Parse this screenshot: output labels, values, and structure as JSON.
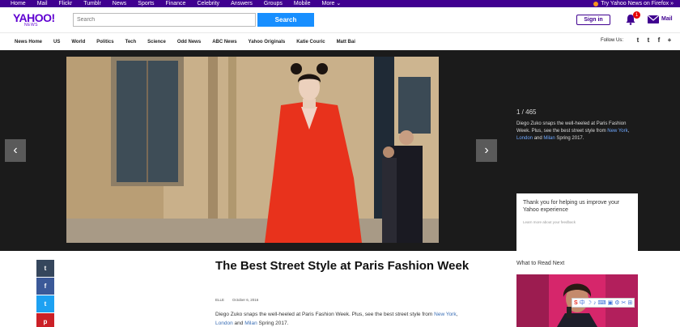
{
  "topbar": {
    "links": [
      "Home",
      "Mail",
      "Flickr",
      "Tumblr",
      "News",
      "Sports",
      "Finance",
      "Celebrity",
      "Answers",
      "Groups",
      "Mobile",
      "More ⌄"
    ],
    "firefox": "Try Yahoo News on Firefox »"
  },
  "header": {
    "logo": "YAHOO!",
    "logo_sub": "NEWS",
    "search_placeholder": "Search",
    "search_button": "Search",
    "signin": "Sign in",
    "notifications_count": "1",
    "mail_label": "Mail"
  },
  "newsnav": {
    "items": [
      "News Home",
      "US",
      "World",
      "Politics",
      "Tech",
      "Science",
      "Odd News",
      "ABC News",
      "Yahoo Originals",
      "Katie Couric",
      "Matt Bai"
    ],
    "follow": "Follow Us:",
    "social": [
      "t",
      "t",
      "f",
      "+"
    ]
  },
  "slideshow": {
    "counter": "1 / 465",
    "caption_text": "Diego Zuko snaps the well-heeled at Paris Fashion Week. Plus, see the best street style from",
    "caption_link1": "New York",
    "caption_sep1": ",",
    "caption_link2": "London",
    "caption_and": "and",
    "caption_link3": "Milan",
    "caption_tail": "Spring 2017.",
    "feedback_title": "Thank you for helping us improve your Yahoo experience",
    "feedback_sub": "Learn more about your feedback"
  },
  "share": {
    "buttons": [
      {
        "label": "t",
        "color": "#35465c"
      },
      {
        "label": "f",
        "color": "#3b5998"
      },
      {
        "label": "t",
        "color": "#1da1f2"
      },
      {
        "label": "p",
        "color": "#cb2027"
      }
    ]
  },
  "article": {
    "title": "The Best Street Style at Paris Fashion Week",
    "source": "ELLE",
    "date": "October 6, 2016",
    "summary_text": "Diego Zuko snaps the well-heeled at Paris Fashion Week. Plus, see the best street style from",
    "link1": "New York",
    "sep": ",",
    "link2": "London",
    "and": "and",
    "link3": "Milan",
    "tail": "Spring 2017."
  },
  "right": {
    "title": "What to Read Next"
  },
  "toolbar": [
    "S",
    "中",
    "☽",
    "♪",
    "⌨",
    "▣",
    "⚙",
    "✂",
    "⊞"
  ]
}
